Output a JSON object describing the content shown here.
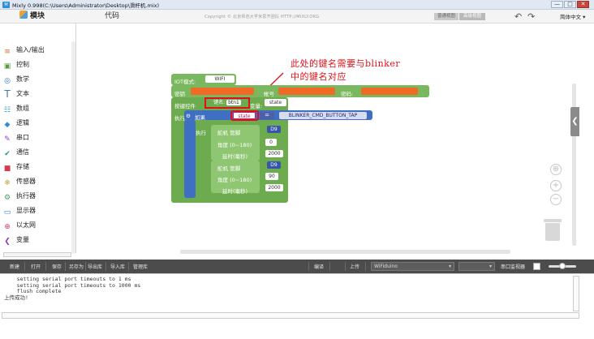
{
  "window": {
    "title": "Mixly 0.998(C:\\Users\\Administrator\\Desktop\\滑杆机.mix)",
    "minimize": "—",
    "maximize": "□",
    "close": "✕"
  },
  "toolbar": {
    "blocks_tab": "模块",
    "code_tab": "代码",
    "copyright": "Copyright © 北京师范大学米思齐团队 HTTP://MIXLY.ORG",
    "normal_view": "普通视图",
    "advanced_view": "高级视图",
    "undo": "↶",
    "redo": "↷",
    "language": "简体中文 ▾"
  },
  "sidebar": {
    "items": [
      {
        "label": "输入/输出",
        "icon": "≡",
        "color": "#e06a2c"
      },
      {
        "label": "控制",
        "icon": "▣",
        "color": "#5a9a3e"
      },
      {
        "label": "数学",
        "icon": "◎",
        "color": "#2f6fd0"
      },
      {
        "label": "文本",
        "icon": "T",
        "color": "#3a7ab8"
      },
      {
        "label": "数组",
        "icon": "☷",
        "color": "#2f9ad0"
      },
      {
        "label": "逻辑",
        "icon": "◆",
        "color": "#2f8ad8"
      },
      {
        "label": "串口",
        "icon": "✎",
        "color": "#8a3ac8"
      },
      {
        "label": "通信",
        "icon": "✔",
        "color": "#2f9a6a"
      },
      {
        "label": "存储",
        "icon": "■",
        "color": "#d83a4a"
      },
      {
        "label": "传感器",
        "icon": "❄",
        "color": "#c89a3a"
      },
      {
        "label": "执行器",
        "icon": "⚙",
        "color": "#4a9a6a"
      },
      {
        "label": "显示器",
        "icon": "▭",
        "color": "#2f7ac8"
      },
      {
        "label": "以太网",
        "icon": "⊕",
        "color": "#c83a6a"
      },
      {
        "label": "变量",
        "icon": "❮",
        "color": "#8a3ab8"
      }
    ]
  },
  "annotation": {
    "line1": "此处的键名需要与blinker",
    "line2": "中的键名对应"
  },
  "blocks": {
    "iot_mode_label": "IOT模式:",
    "iot_mode_value": "WIFI",
    "secret_label": "密钥",
    "account_label": "帐号",
    "password_label": "密码:",
    "button_control_label": "按键控件",
    "key_name_label": "键名:",
    "key_name_value": "btn1",
    "variable_label": "变量:",
    "variable_value": "state",
    "execute_label": "执行",
    "if_label": "如果",
    "cond_var": "state",
    "cond_op": "=",
    "cond_value": "BLINKER_CMD_BUTTON_TAP",
    "do_label": "执行",
    "servo1_label": "舵机 管脚",
    "servo1_pin": "D9",
    "angle1_label": "角度 (0~180)",
    "angle1_value": "0",
    "delay1_label": "延时(毫秒)",
    "delay1_value": "2000",
    "servo2_label": "舵机 管脚",
    "servo2_pin": "D9",
    "angle2_label": "角度 (0~180)",
    "angle2_value": "90",
    "delay2_label": "延时(毫秒)",
    "delay2_value": "2000"
  },
  "workspace": {
    "collapse_icon": "❮",
    "zoom_center": "⊕",
    "zoom_in": "+",
    "zoom_out": "−"
  },
  "bottombar": {
    "new": "新建",
    "open": "打开",
    "save": "保存",
    "save_as": "另存为",
    "export_lib": "导出库",
    "import_lib": "导入库",
    "manage_lib": "管理库",
    "compile": "编译",
    "upload": "上传",
    "board": "WiFiduino",
    "port": "",
    "serial_monitor": "串口监视器"
  },
  "console": {
    "text": "    setting serial port timeouts to 1 ms\n    setting serial port timeouts to 1000 ms\n    flush complete\n上传成功!"
  }
}
